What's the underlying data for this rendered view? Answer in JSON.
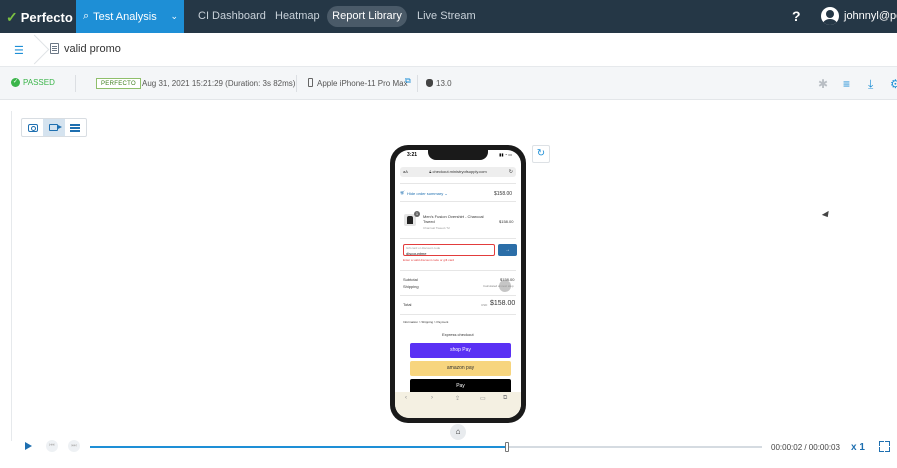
{
  "nav": {
    "logo": "Perfecto",
    "active_label": "Test Analysis",
    "items": [
      "CI Dashboard",
      "Heatmap",
      "Report Library",
      "Live Stream"
    ],
    "help": "?",
    "user": "johnnyl@per"
  },
  "breadcrumb": {
    "title": "valid promo"
  },
  "status": {
    "result": "PASSED",
    "badge": "PERFECTO",
    "date": "Aug 31, 2021 15:21:29 (Duration: 3s 82ms)",
    "device": "Apple iPhone-11 Pro Max",
    "os": "13.0"
  },
  "phone_screen": {
    "time": "3:21",
    "url": "checkout.ministryofsupply.com",
    "url_aa": "aA",
    "order_summary": "Hide order summary ⌄",
    "order_total_top": "$158.00",
    "qty": "1",
    "item_name": "Men's Fusion Overshirt - Charcoal Tweed",
    "item_variant": "Charcoal Tweed / M",
    "item_price": "$158.00",
    "promo_label": "Gift card or discount code",
    "promo_value": "discountme",
    "promo_error": "Enter a valid discount code or gift card",
    "apply": "→",
    "subtotal_label": "Subtotal",
    "subtotal_value": "$158.00",
    "shipping_label": "Shipping",
    "shipping_value": "Calculated at next step",
    "total_label": "Total",
    "total_currency": "USD",
    "total_value": "$158.00",
    "steps": "Information  >  Shipping  >  Payment",
    "express": "Express checkout",
    "shop_pay": "shop Pay",
    "amazon_pay": "amazon pay",
    "apple_pay": " Pay"
  },
  "player": {
    "time": "00:00:02 / 00:00:03",
    "speed": "x 1",
    "progress_fraction": 0.62
  },
  "colors": {
    "nav_bg": "#253746",
    "accent": "#1e8fd6",
    "passed": "#3bb54a",
    "shop_pay": "#5a31f4",
    "amazon_pay": "#f7d57e"
  }
}
